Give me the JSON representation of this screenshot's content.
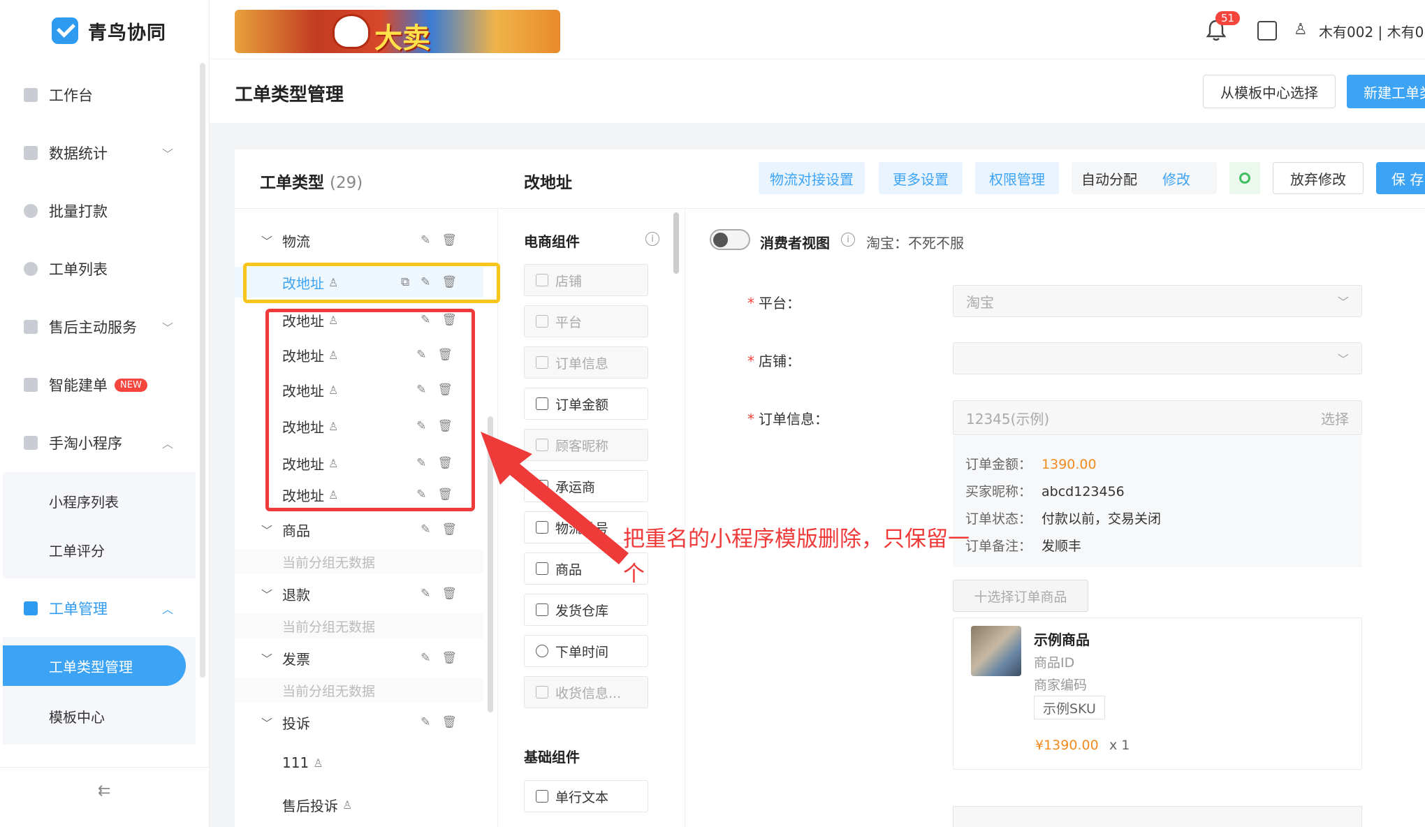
{
  "app": {
    "name": "青鸟协同"
  },
  "sidebar": {
    "items": [
      {
        "label": "工作台"
      },
      {
        "label": "数据统计"
      },
      {
        "label": "批量打款"
      },
      {
        "label": "工单列表"
      },
      {
        "label": "售后主动服务"
      },
      {
        "label": "智能建单",
        "badge": "NEW"
      },
      {
        "label": "手淘小程序"
      },
      {
        "label": "工单管理"
      }
    ],
    "mini_program_sub": [
      {
        "label": "小程序列表"
      },
      {
        "label": "工单评分"
      }
    ],
    "ticket_mgmt_sub": [
      {
        "label": "工单类型管理"
      },
      {
        "label": "模板中心"
      }
    ],
    "collapse_icon": "⇇"
  },
  "topbar": {
    "banner_text": "大卖",
    "notification_count": "51",
    "user_text": "木有002 | 木有0"
  },
  "header": {
    "title": "工单类型管理",
    "template_button": "从模板中心选择",
    "new_button": "新建工单类"
  },
  "panel": {
    "types_title": "工单类型",
    "types_count": "(29)",
    "current_type": "改地址",
    "tabs": {
      "logistics": "物流对接设置",
      "more": "更多设置",
      "permission": "权限管理"
    },
    "auto_assign": {
      "label": "自动分配",
      "link": "修改"
    },
    "discard_button": "放弃修改",
    "save_button": "保 存"
  },
  "tree": {
    "groups": {
      "logistics": "物流",
      "goods": "商品",
      "refund": "退款",
      "invoice": "发票",
      "complaint": "投诉"
    },
    "leaf_name": "改地址",
    "empty_text": "当前分组无数据",
    "complaint_items": [
      "111",
      "售后投诉"
    ]
  },
  "components": {
    "ecommerce_title": "电商组件",
    "basic_title": "基础组件",
    "items": [
      {
        "label": "店铺"
      },
      {
        "label": "平台"
      },
      {
        "label": "订单信息"
      },
      {
        "label": "订单金额"
      },
      {
        "label": "顾客昵称"
      },
      {
        "label": "承运商"
      },
      {
        "label": "物流单号"
      },
      {
        "label": "商品"
      },
      {
        "label": "发货仓库"
      },
      {
        "label": "下单时间"
      },
      {
        "label": "收货信息..."
      }
    ],
    "basic_items": [
      {
        "label": "单行文本"
      }
    ]
  },
  "form": {
    "consumer_view_label": "消费者视图",
    "consumer_shop": "淘宝：不死不服",
    "platform_label": "平台：",
    "platform_value": "淘宝",
    "shop_label": "店铺：",
    "order_label": "订单信息：",
    "order_placeholder": "12345(示例)",
    "order_choose": "选择",
    "order_details": {
      "amount_label": "订单金额：",
      "amount": "1390.00",
      "buyer_label": "买家昵称：",
      "buyer": "abcd123456",
      "status_label": "订单状态：",
      "status": "付款以前，交易关闭",
      "remark_label": "订单备注：",
      "remark": "发顺丰"
    },
    "add_goods": "十选择订单商品",
    "goods": {
      "name": "示例商品",
      "id_label": "商品ID",
      "code_label": "商家编码",
      "sku": "示例SKU",
      "price": "¥1390.00",
      "qty": "x 1"
    }
  },
  "annotation": {
    "line1": "把重名的小程序模版删除，只保留一",
    "line2": "个"
  },
  "colors": {
    "primary": "#3da4f5",
    "annotation_red": "#ef3a3a",
    "annotation_yellow": "#f8c51c",
    "price_orange": "#f28a1e"
  }
}
